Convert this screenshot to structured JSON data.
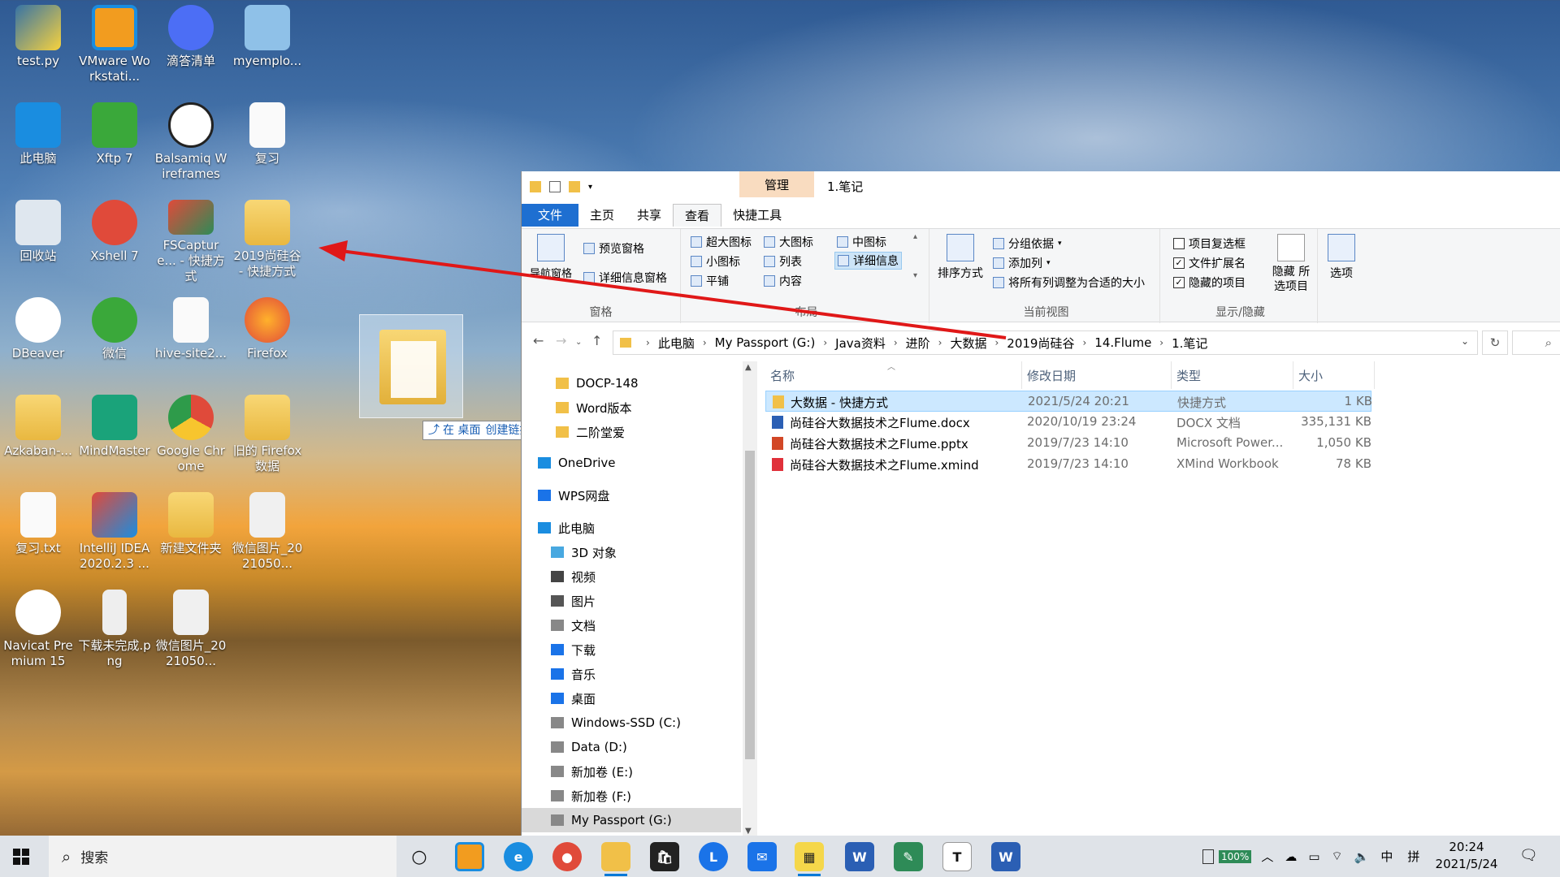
{
  "desktop": {
    "icons": [
      {
        "label": "test.py",
        "icon": "python-icon"
      },
      {
        "label": "VMware Workstati...",
        "icon": "vmware-icon"
      },
      {
        "label": "滴答清单",
        "icon": "ticktick-icon"
      },
      {
        "label": "myemplo...",
        "icon": "notepad-file-icon"
      },
      {
        "label": "此电脑",
        "icon": "computer-icon"
      },
      {
        "label": "Xftp 7",
        "icon": "xftp-icon"
      },
      {
        "label": "Balsamiq Wireframes",
        "icon": "balsamiq-icon"
      },
      {
        "label": "复习",
        "icon": "blank-file-icon"
      },
      {
        "label": "回收站",
        "icon": "recycle-bin-icon"
      },
      {
        "label": "Xshell 7",
        "icon": "xshell-icon"
      },
      {
        "label": "FSCapture... - 快捷方式",
        "icon": "fscapture-icon"
      },
      {
        "label": "2019尚硅谷 - 快捷方式",
        "icon": "folder-shortcut-icon"
      },
      {
        "label": "DBeaver",
        "icon": "dbeaver-icon"
      },
      {
        "label": "微信",
        "icon": "wechat-icon"
      },
      {
        "label": "hive-site2...",
        "icon": "blank-file-icon"
      },
      {
        "label": "Firefox",
        "icon": "firefox-icon"
      },
      {
        "label": "Azkaban-...",
        "icon": "folder-icon"
      },
      {
        "label": "MindMaster",
        "icon": "mindmaster-icon"
      },
      {
        "label": "Google Chrome",
        "icon": "chrome-icon"
      },
      {
        "label": "旧的 Firefox 数据",
        "icon": "folder-icon"
      },
      {
        "label": "复习.txt",
        "icon": "text-file-icon"
      },
      {
        "label": "IntelliJ IDEA 2020.2.3 ...",
        "icon": "intellij-icon"
      },
      {
        "label": "新建文件夹",
        "icon": "folder-icon"
      },
      {
        "label": "微信图片_2021050...",
        "icon": "image-file-icon"
      },
      {
        "label": "Navicat Premium 15",
        "icon": "navicat-icon"
      },
      {
        "label": "下载未完成.png",
        "icon": "png-file-icon"
      },
      {
        "label": "微信图片_2021050...",
        "icon": "image-file-icon"
      }
    ],
    "drag_tooltip": {
      "arrow": "⤴",
      "prefix": "在 桌面",
      "action": "创建链接"
    }
  },
  "explorer": {
    "window_title": "1.笔记",
    "context_tab": "管理",
    "tabs": [
      {
        "label": "文件"
      },
      {
        "label": "主页"
      },
      {
        "label": "共享"
      },
      {
        "label": "查看"
      },
      {
        "label": "快捷工具"
      }
    ],
    "ribbon": {
      "pane_group": {
        "label": "窗格",
        "nav_pane": "导航窗格",
        "preview": "预览窗格",
        "details": "详细信息窗格"
      },
      "layout_group": {
        "label": "布局",
        "items": [
          "超大图标",
          "大图标",
          "中图标",
          "小图标",
          "列表",
          "详细信息",
          "平铺",
          "内容"
        ]
      },
      "view_group": {
        "label": "当前视图",
        "sort": "排序方式",
        "group_by": "分组依据",
        "add_col": "添加列",
        "fit_cols": "将所有列调整为合适的大小"
      },
      "show_group": {
        "label": "显示/隐藏",
        "checkbox_items": [
          {
            "label": "项目复选框",
            "checked": false
          },
          {
            "label": "文件扩展名",
            "checked": true
          },
          {
            "label": "隐藏的项目",
            "checked": true
          }
        ],
        "hide_selected": "隐藏 所选项目"
      },
      "options": "选项"
    },
    "address": {
      "crumbs": [
        "此电脑",
        "My Passport (G:)",
        "Java资料",
        "进阶",
        "大数据",
        "2019尚硅谷",
        "14.Flume",
        "1.笔记"
      ]
    },
    "nav_items": [
      {
        "label": "DOCP-148",
        "icon": "folder-icon"
      },
      {
        "label": "Word版本",
        "icon": "folder-icon"
      },
      {
        "label": "二阶堂爱",
        "icon": "folder-icon"
      },
      {
        "label": "OneDrive",
        "icon": "onedrive-icon"
      },
      {
        "label": "WPS网盘",
        "icon": "wps-cloud-icon"
      },
      {
        "label": "此电脑",
        "icon": "computer-icon"
      },
      {
        "label": "3D 对象",
        "icon": "3d-objects-icon"
      },
      {
        "label": "视频",
        "icon": "video-icon"
      },
      {
        "label": "图片",
        "icon": "pictures-icon"
      },
      {
        "label": "文档",
        "icon": "documents-icon"
      },
      {
        "label": "下载",
        "icon": "download-icon"
      },
      {
        "label": "音乐",
        "icon": "music-icon"
      },
      {
        "label": "桌面",
        "icon": "desktop-icon"
      },
      {
        "label": "Windows-SSD (C:)",
        "icon": "drive-icon"
      },
      {
        "label": "Data (D:)",
        "icon": "drive-icon"
      },
      {
        "label": "新加卷 (E:)",
        "icon": "drive-icon"
      },
      {
        "label": "新加卷 (F:)",
        "icon": "drive-icon"
      },
      {
        "label": "My Passport (G:)",
        "icon": "drive-icon"
      }
    ],
    "columns": [
      "名称",
      "修改日期",
      "类型",
      "大小"
    ],
    "files": [
      {
        "name": "大数据 - 快捷方式",
        "date": "2021/5/24 20:21",
        "type": "快捷方式",
        "size": "1 KB",
        "icon": "folder-shortcut-icon",
        "color": "#f1c048"
      },
      {
        "name": "尚硅谷大数据技术之Flume.docx",
        "date": "2020/10/19 23:24",
        "type": "DOCX 文档",
        "size": "335,131 KB",
        "icon": "word-doc-icon",
        "color": "#2b5fb4"
      },
      {
        "name": "尚硅谷大数据技术之Flume.pptx",
        "date": "2019/7/23 14:10",
        "type": "Microsoft Power...",
        "size": "1,050 KB",
        "icon": "ppt-icon",
        "color": "#d24726"
      },
      {
        "name": "尚硅谷大数据技术之Flume.xmind",
        "date": "2019/7/23 14:10",
        "type": "XMind Workbook",
        "size": "78 KB",
        "icon": "xmind-icon",
        "color": "#e0303a"
      }
    ]
  },
  "taskbar": {
    "search_placeholder": "搜索",
    "battery": "100%",
    "ime_lang": "中",
    "ime_mode": "拼",
    "time": "20:24",
    "date": "2021/5/24"
  }
}
